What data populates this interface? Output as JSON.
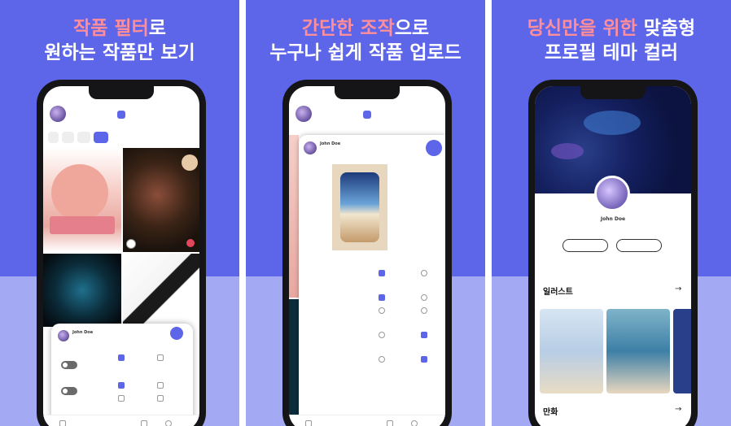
{
  "panels": [
    {
      "headline_accent": "작품 필터",
      "headline_rest": "로",
      "headline_line2": "원하는 작품만 보기"
    },
    {
      "headline_accent": "간단한 조작",
      "headline_rest": "으로",
      "headline_line2": "누구나 쉽게 작품 업로드"
    },
    {
      "headline_accent": "당신만을 위한",
      "headline_rest": " 맞춤형",
      "headline_line2": "프로필 테마 컬러"
    }
  ],
  "uploader": {
    "name": "John Doe"
  },
  "profile": {
    "name": "John Doe"
  },
  "sections": {
    "illustrations": "일러스트",
    "comics": "만화"
  },
  "colors": {
    "accent": "#5d66e8",
    "highlight_text": "#ff8e9a"
  },
  "icons": [
    "avatar-icon",
    "chat-icon",
    "pen-icon",
    "send-icon",
    "arrow-right-icon",
    "home-icon",
    "plus-icon"
  ]
}
